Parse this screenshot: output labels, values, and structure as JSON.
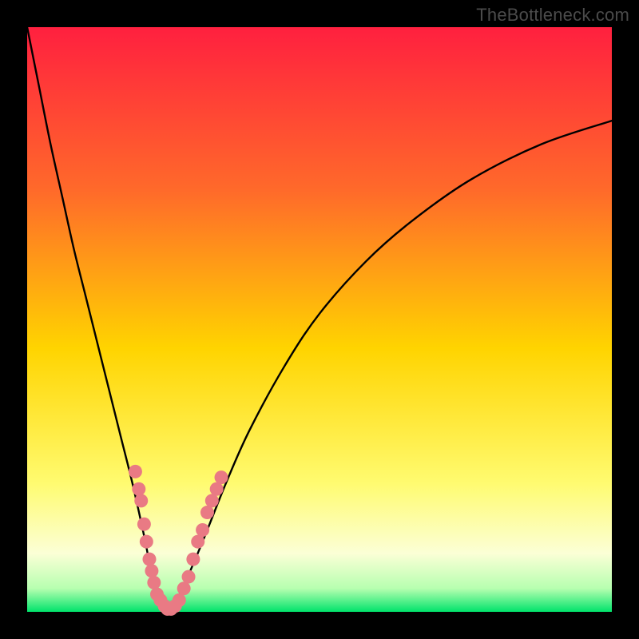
{
  "watermark": "TheBottleneck.com",
  "colors": {
    "frame": "#000000",
    "grad_top": "#ff203f",
    "grad_mid1": "#ff7a1e",
    "grad_mid2": "#ffd400",
    "grad_mid3": "#fffb70",
    "grad_low": "#fbffd6",
    "grad_bottom": "#00e36b",
    "curve": "#000000",
    "dots": "#e97a84"
  },
  "chart_data": {
    "type": "line",
    "title": "",
    "xlabel": "",
    "ylabel": "",
    "xlim": [
      0,
      100
    ],
    "ylim": [
      0,
      100
    ],
    "series": [
      {
        "name": "bottleneck-curve",
        "x": [
          0,
          2,
          4,
          6,
          8,
          10,
          12,
          14,
          16,
          18,
          20,
          21,
          22,
          23,
          24,
          25,
          27,
          30,
          34,
          38,
          44,
          50,
          58,
          66,
          76,
          88,
          100
        ],
        "y": [
          100,
          90,
          80,
          71,
          62,
          54,
          46,
          38,
          30,
          22,
          13,
          8,
          4,
          1,
          0,
          1,
          5,
          12,
          22,
          31,
          42,
          51,
          60,
          67,
          74,
          80,
          84
        ]
      }
    ],
    "scatter": {
      "name": "sample-dots",
      "points": [
        {
          "x": 18.5,
          "y": 24
        },
        {
          "x": 19.1,
          "y": 21
        },
        {
          "x": 19.5,
          "y": 19
        },
        {
          "x": 20.0,
          "y": 15
        },
        {
          "x": 20.4,
          "y": 12
        },
        {
          "x": 20.9,
          "y": 9
        },
        {
          "x": 21.3,
          "y": 7
        },
        {
          "x": 21.7,
          "y": 5
        },
        {
          "x": 22.2,
          "y": 3
        },
        {
          "x": 22.8,
          "y": 2
        },
        {
          "x": 23.5,
          "y": 1
        },
        {
          "x": 24.0,
          "y": 0.5
        },
        {
          "x": 24.6,
          "y": 0.5
        },
        {
          "x": 25.3,
          "y": 1
        },
        {
          "x": 26.0,
          "y": 2
        },
        {
          "x": 26.8,
          "y": 4
        },
        {
          "x": 27.6,
          "y": 6
        },
        {
          "x": 28.4,
          "y": 9
        },
        {
          "x": 29.2,
          "y": 12
        },
        {
          "x": 30.0,
          "y": 14
        },
        {
          "x": 30.8,
          "y": 17
        },
        {
          "x": 31.6,
          "y": 19
        },
        {
          "x": 32.4,
          "y": 21
        },
        {
          "x": 33.2,
          "y": 23
        }
      ]
    }
  }
}
